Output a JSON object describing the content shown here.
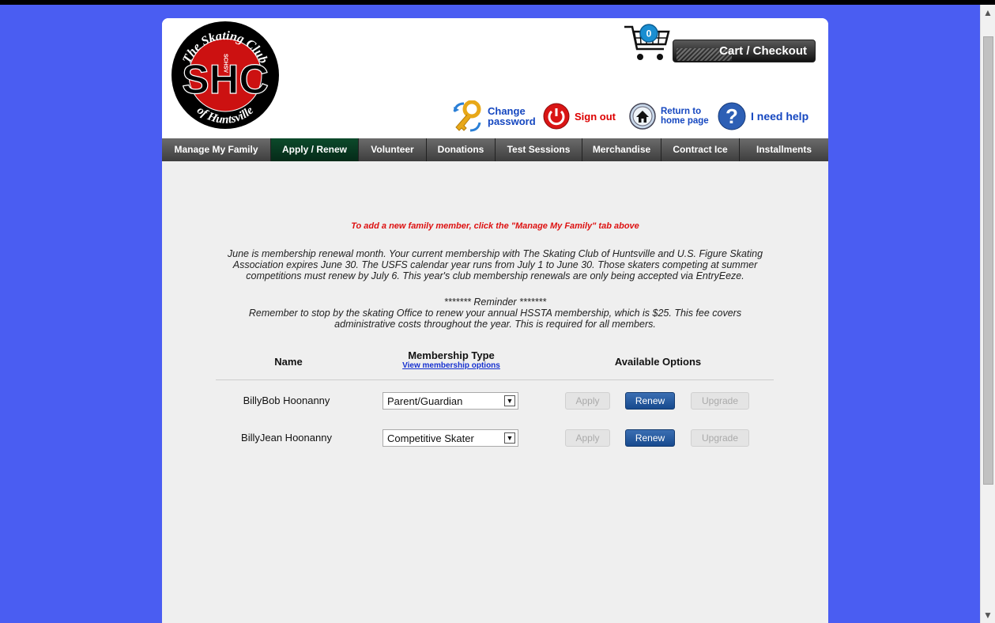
{
  "header": {
    "logo": {
      "text_top": "The Skating Club",
      "monogram": "SHC",
      "vertical": "SCHSV",
      "text_bottom": "of Huntsville",
      "colors": {
        "outer": "#000000",
        "inner": "#cc1111"
      }
    },
    "cart": {
      "count": "0",
      "label": "Cart / Checkout"
    },
    "links": {
      "change_password_line1": "Change",
      "change_password_line2": "password",
      "sign_out": "Sign out",
      "return_line1": "Return to",
      "return_line2": "home page",
      "help": "I need help"
    }
  },
  "nav": {
    "tabs": [
      {
        "label": "Manage My Family"
      },
      {
        "label": "Apply / Renew",
        "active": true
      },
      {
        "label": "Volunteer"
      },
      {
        "label": "Donations"
      },
      {
        "label": "Test Sessions"
      },
      {
        "label": "Merchandise"
      },
      {
        "label": "Contract Ice"
      },
      {
        "label": "Installments"
      }
    ]
  },
  "main": {
    "notice": "To add a new family member, click the \"Manage My Family\" tab above",
    "renewal_lines": [
      "June is membership renewal month. Your current membership with The Skating Club of Huntsville and U.S. Figure Skating",
      "Association expires June 30. The USFS calendar year runs from July 1 to June 30. Those skaters competing at summer",
      "competitions must renew by July 6. This year's club membership renewals are only being accepted via EntryEeze."
    ],
    "reminder_lines": [
      "******* Reminder *******",
      "Remember to stop by the skating Office to renew your annual HSSTA membership, which is $25. This fee covers",
      "administrative costs throughout the year. This is required for all members."
    ],
    "table": {
      "col_name": "Name",
      "col_type": "Membership Type",
      "col_type_link": "View membership options",
      "col_options": "Available Options",
      "rows": [
        {
          "name": "BillyBob Hoonanny",
          "type": "Parent/Guardian",
          "apply": "Apply",
          "renew": "Renew",
          "upgrade": "Upgrade"
        },
        {
          "name": "BillyJean Hoonanny",
          "type": "Competitive Skater",
          "apply": "Apply",
          "renew": "Renew",
          "upgrade": "Upgrade"
        }
      ]
    }
  },
  "colors": {
    "background": "#4a5df2",
    "active_tab": "#0c4a2b",
    "primary_button": "#1f5298",
    "notice": "#dd1111",
    "link_blue": "#1547c0"
  }
}
